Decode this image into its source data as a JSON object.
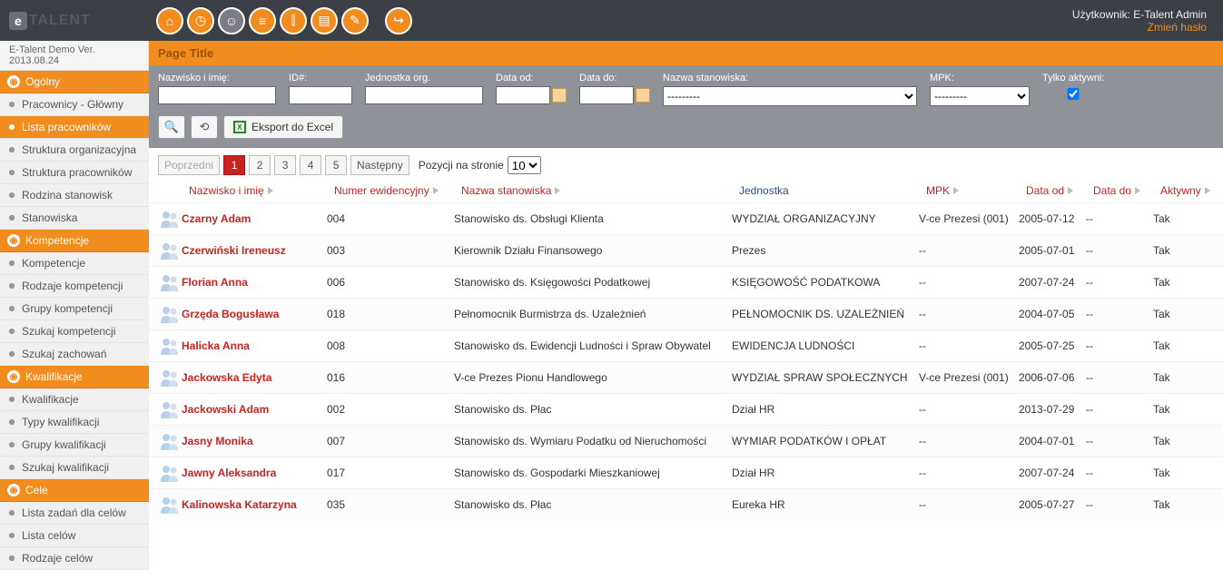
{
  "header": {
    "logo_prefix": "e",
    "logo_text": "TALENT",
    "user_label": "Użytkownik:",
    "user_name": "E-Talent Admin",
    "change_password": "Zmień hasło",
    "demo_version": "E-Talent Demo Ver. 2013.08.24"
  },
  "sidebar": {
    "sections": [
      {
        "title": "Ogólny",
        "items": [
          {
            "label": "Pracownicy - Główny",
            "active": false
          },
          {
            "label": "Lista pracowników",
            "active": true
          },
          {
            "label": "Struktura organizacyjna",
            "active": false
          },
          {
            "label": "Struktura pracowników",
            "active": false
          },
          {
            "label": "Rodzina stanowisk",
            "active": false
          },
          {
            "label": "Stanowiska",
            "active": false
          }
        ]
      },
      {
        "title": "Kompetencje",
        "items": [
          {
            "label": "Kompetencje",
            "active": false
          },
          {
            "label": "Rodzaje kompetencji",
            "active": false
          },
          {
            "label": "Grupy kompetencji",
            "active": false
          },
          {
            "label": "Szukaj kompetencji",
            "active": false
          },
          {
            "label": "Szukaj zachowań",
            "active": false
          }
        ]
      },
      {
        "title": "Kwalifikacje",
        "items": [
          {
            "label": "Kwalifikacje",
            "active": false
          },
          {
            "label": "Typy kwalifikacji",
            "active": false
          },
          {
            "label": "Grupy kwalifikacji",
            "active": false
          },
          {
            "label": "Szukaj kwalifikacji",
            "active": false
          }
        ]
      },
      {
        "title": "Cele",
        "items": [
          {
            "label": "Lista zadań dla celów",
            "active": false
          },
          {
            "label": "Lista celów",
            "active": false
          },
          {
            "label": "Rodzaje celów",
            "active": false
          }
        ]
      }
    ]
  },
  "page": {
    "title": "Page Title"
  },
  "filters": {
    "name_label": "Nazwisko i imię:",
    "id_label": "ID#:",
    "unit_label": "Jednostka org.",
    "date_from_label": "Data od:",
    "date_to_label": "Data do:",
    "position_label": "Nazwa stanowiska:",
    "mpk_label": "MPK:",
    "active_only_label": "Tylko aktywni:",
    "select_placeholder": "---------",
    "active_checked": true,
    "export_label": "Eksport do Excel"
  },
  "pagination": {
    "prev": "Poprzedni",
    "next": "Następny",
    "pages": [
      "1",
      "2",
      "3",
      "4",
      "5"
    ],
    "current": "1",
    "size_label": "Pozycji na stronie",
    "size_value": "10"
  },
  "table": {
    "headers": {
      "name": "Nazwisko i imię",
      "id": "Numer ewidencyjny",
      "position": "Nazwa stanowiska",
      "unit": "Jednostka",
      "mpk": "MPK",
      "date_from": "Data od",
      "date_to": "Data do",
      "active": "Aktywny"
    },
    "rows": [
      {
        "name": "Czarny Adam",
        "id": "004",
        "position": "Stanowisko ds. Obsługi Klienta",
        "unit": "WYDZIAŁ ORGANIZACYJNY",
        "mpk": "V-ce Prezesi (001)",
        "from": "2005-07-12",
        "to": "--",
        "active": "Tak"
      },
      {
        "name": "Czerwiński Ireneusz",
        "id": "003",
        "position": "Kierownik Działu Finansowego",
        "unit": "Prezes",
        "mpk": "--",
        "from": "2005-07-01",
        "to": "--",
        "active": "Tak"
      },
      {
        "name": "Florian Anna",
        "id": "006",
        "position": "Stanowisko ds. Księgowości Podatkowej",
        "unit": "KSIĘGOWOŚĆ PODATKOWA",
        "mpk": "--",
        "from": "2007-07-24",
        "to": "--",
        "active": "Tak"
      },
      {
        "name": "Grzęda Bogusława",
        "id": "018",
        "position": "Pełnomocnik Burmistrza ds. Uzależnień",
        "unit": "PEŁNOMOCNIK DS. UZALEŻNIEŃ",
        "mpk": "--",
        "from": "2004-07-05",
        "to": "--",
        "active": "Tak"
      },
      {
        "name": "Halicka Anna",
        "id": "008",
        "position": "Stanowisko ds. Ewidencji Ludności i Spraw Obywatel",
        "unit": "EWIDENCJA LUDNOŚCI",
        "mpk": "--",
        "from": "2005-07-25",
        "to": "--",
        "active": "Tak"
      },
      {
        "name": "Jackowska Edyta",
        "id": "016",
        "position": "V-ce Prezes Pionu Handlowego",
        "unit": "WYDZIAŁ SPRAW SPOŁECZNYCH",
        "mpk": "V-ce Prezesi (001)",
        "from": "2006-07-06",
        "to": "--",
        "active": "Tak"
      },
      {
        "name": "Jackowski Adam",
        "id": "002",
        "position": "Stanowisko ds. Płac",
        "unit": "Dział HR",
        "mpk": "--",
        "from": "2013-07-29",
        "to": "--",
        "active": "Tak"
      },
      {
        "name": "Jasny Monika",
        "id": "007",
        "position": "Stanowisko ds. Wymiaru Podatku od Nieruchomości",
        "unit": "WYMIAR PODATKÓW I OPŁAT",
        "mpk": "--",
        "from": "2004-07-01",
        "to": "--",
        "active": "Tak"
      },
      {
        "name": "Jawny Aleksandra",
        "id": "017",
        "position": "Stanowisko ds. Gospodarki Mieszkaniowej",
        "unit": "Dział HR",
        "mpk": "--",
        "from": "2007-07-24",
        "to": "--",
        "active": "Tak"
      },
      {
        "name": "Kalinowska Katarzyna",
        "id": "035",
        "position": "Stanowisko ds. Płac",
        "unit": "Eureka HR",
        "mpk": "--",
        "from": "2005-07-27",
        "to": "--",
        "active": "Tak"
      }
    ]
  }
}
